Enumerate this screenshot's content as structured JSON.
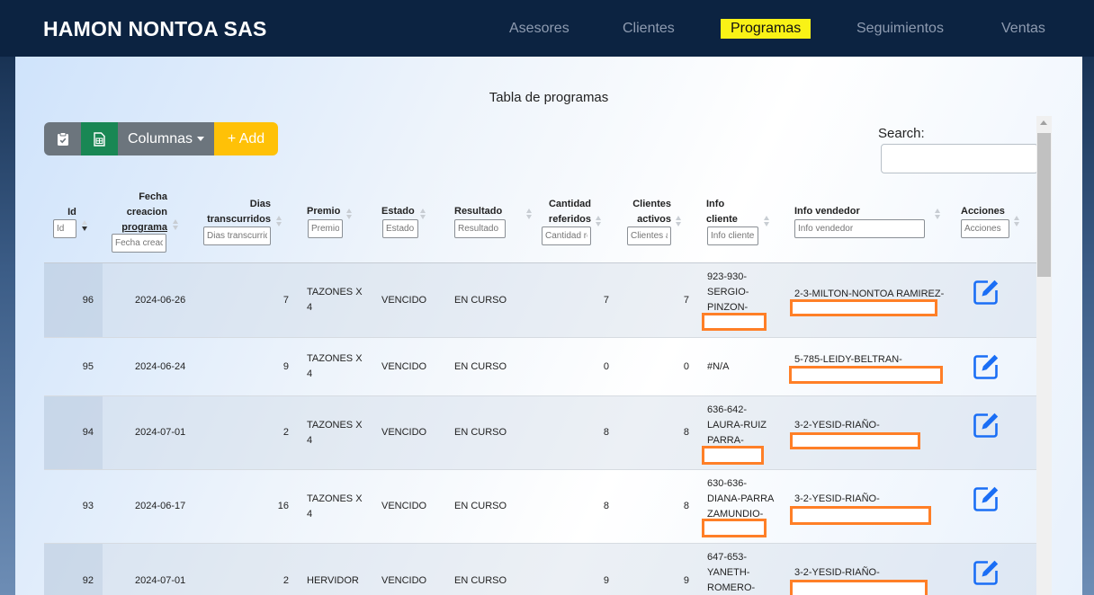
{
  "navbar": {
    "brand": "HAMON NONTOA SAS",
    "links": [
      "Asesores",
      "Clientes",
      "Programas",
      "Seguimientos",
      "Ventas"
    ],
    "active": "Programas"
  },
  "page": {
    "title": "Tabla de programas",
    "buttons": {
      "copy_icon": "clipboard-icon",
      "excel_icon": "spreadsheet-icon",
      "columns_label": "Columnas",
      "add_label": "+ Add"
    },
    "search_label": "Search:",
    "search_value": ""
  },
  "table": {
    "headers": [
      {
        "lines": [
          "Id"
        ],
        "filter_placeholder": "Id"
      },
      {
        "lines": [
          "Fecha",
          "creacion",
          "programa"
        ],
        "filter_placeholder": "Fecha creacion programa"
      },
      {
        "lines": [
          "Dias",
          "transcurridos"
        ],
        "filter_placeholder": "Dias transcurridos"
      },
      {
        "lines": [
          "Premio"
        ],
        "filter_placeholder": "Premio"
      },
      {
        "lines": [
          "Estado"
        ],
        "filter_placeholder": "Estado"
      },
      {
        "lines": [
          "Resultado"
        ],
        "filter_placeholder": "Resultado"
      },
      {
        "lines": [
          "Cantidad",
          "referidos"
        ],
        "filter_placeholder": "Cantidad referidos"
      },
      {
        "lines": [
          "Clientes",
          "activos"
        ],
        "filter_placeholder": "Clientes activos"
      },
      {
        "lines": [
          "Info",
          "cliente"
        ],
        "filter_placeholder": "Info cliente"
      },
      {
        "lines": [
          "Info vendedor"
        ],
        "filter_placeholder": "Info vendedor"
      },
      {
        "lines": [
          "Acciones"
        ],
        "filter_placeholder": "Acciones"
      }
    ],
    "rows": [
      {
        "id": "96",
        "fecha": "2024-06-26",
        "dias": "7",
        "premio": [
          "TAZONES X",
          "4"
        ],
        "estado": "VENCIDO",
        "resultado": "EN CURSO",
        "referidos": "7",
        "activos": "7",
        "cliente": [
          "923-930-",
          "SERGIO-",
          "PINZON-"
        ],
        "vendedor": "2-3-MILTON-NONTOA RAMIREZ-"
      },
      {
        "id": "95",
        "fecha": "2024-06-24",
        "dias": "9",
        "premio": [
          "TAZONES X",
          "4"
        ],
        "estado": "VENCIDO",
        "resultado": "EN CURSO",
        "referidos": "0",
        "activos": "0",
        "cliente": [
          "#N/A"
        ],
        "vendedor": "5-785-LEIDY-BELTRAN-"
      },
      {
        "id": "94",
        "fecha": "2024-07-01",
        "dias": "2",
        "premio": [
          "TAZONES X",
          "4"
        ],
        "estado": "VENCIDO",
        "resultado": "EN CURSO",
        "referidos": "8",
        "activos": "8",
        "cliente": [
          "636-642-",
          "LAURA-RUIZ",
          "PARRA-"
        ],
        "vendedor": "3-2-YESID-RIAÑO-"
      },
      {
        "id": "93",
        "fecha": "2024-06-17",
        "dias": "16",
        "premio": [
          "TAZONES X",
          "4"
        ],
        "estado": "VENCIDO",
        "resultado": "EN CURSO",
        "referidos": "8",
        "activos": "8",
        "cliente": [
          "630-636-",
          "DIANA-PARRA",
          "ZAMUNDIO-"
        ],
        "vendedor": "3-2-YESID-RIAÑO-"
      },
      {
        "id": "92",
        "fecha": "2024-07-01",
        "dias": "2",
        "premio": [
          "HERVIDOR"
        ],
        "estado": "VENCIDO",
        "resultado": "EN CURSO",
        "referidos": "9",
        "activos": "9",
        "cliente": [
          "647-653-",
          "YANETH-",
          "ROMERO-"
        ],
        "vendedor": "3-2-YESID-RIAÑO-"
      }
    ],
    "action_icon": "edit-icon"
  },
  "colors": {
    "navbar": "#0c2341",
    "active_nav": "#f9f216",
    "btn_secondary": "#6c757d",
    "btn_excel": "#198754",
    "btn_add": "#ffc107",
    "edit_icon": "#1a6ef5",
    "redaction": "#ff7f27"
  }
}
